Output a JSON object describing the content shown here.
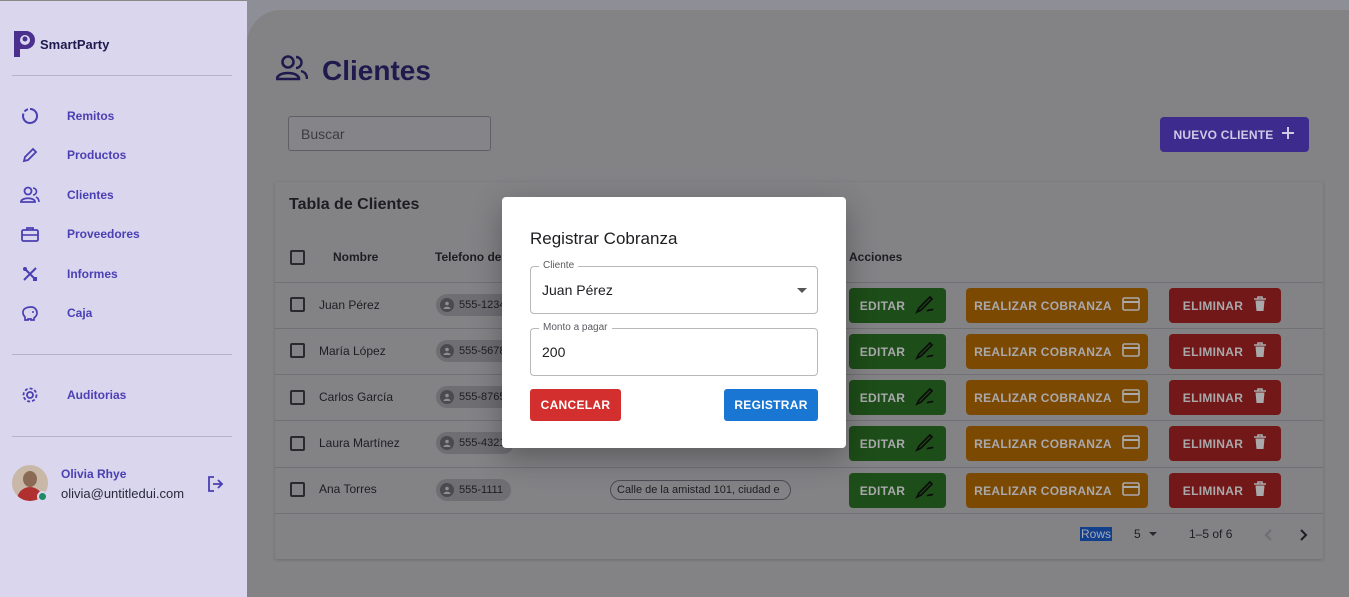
{
  "app": {
    "name": "SmartParty"
  },
  "sidebar": {
    "items": [
      {
        "label": "Remitos",
        "icon": "circle-progress-icon"
      },
      {
        "label": "Productos",
        "icon": "pencil-icon"
      },
      {
        "label": "Clientes",
        "icon": "users-icon"
      },
      {
        "label": "Proveedores",
        "icon": "briefcase-icon"
      },
      {
        "label": "Informes",
        "icon": "tools-icon"
      },
      {
        "label": "Caja",
        "icon": "piggy-bank-icon"
      }
    ],
    "secondary": [
      {
        "label": "Auditorias",
        "icon": "gear-icon"
      }
    ],
    "user": {
      "name": "Olivia Rhye",
      "email": "olivia@untitledui.com"
    }
  },
  "page": {
    "title": "Clientes",
    "search_placeholder": "Buscar",
    "new_button": "NUEVO CLIENTE"
  },
  "table": {
    "title": "Tabla de Clientes",
    "columns": [
      "Nombre",
      "Telefono del",
      "Acciones"
    ],
    "rows": [
      {
        "name": "Juan Pérez",
        "phone": "555-1234",
        "address": ""
      },
      {
        "name": "María López",
        "phone": "555-5678",
        "address": ""
      },
      {
        "name": "Carlos García",
        "phone": "555-8765",
        "address": ""
      },
      {
        "name": "Laura Martínez",
        "phone": "555-4321",
        "address": ""
      },
      {
        "name": "Ana Torres",
        "phone": "555-1111",
        "address": "Calle de la amistad 101, ciudad e"
      }
    ],
    "actions": {
      "edit": "EDITAR",
      "collect": "REALIZAR COBRANZA",
      "delete": "ELIMINAR"
    },
    "pagination": {
      "rows_label": "Rows",
      "rows_per_page": "5",
      "range": "1–5 of 6"
    }
  },
  "dialog": {
    "title": "Registrar Cobranza",
    "client_label": "Cliente",
    "client_value": "Juan Pérez",
    "amount_label": "Monto a pagar",
    "amount_value": "200",
    "cancel": "CANCELAR",
    "submit": "REGISTRAR"
  },
  "colors": {
    "accent": "#4a3fb3",
    "edit": "#1d4d18",
    "collect": "#7c4903",
    "delete": "#731818",
    "cancel": "#d32f2f",
    "submit": "#1976d2"
  }
}
